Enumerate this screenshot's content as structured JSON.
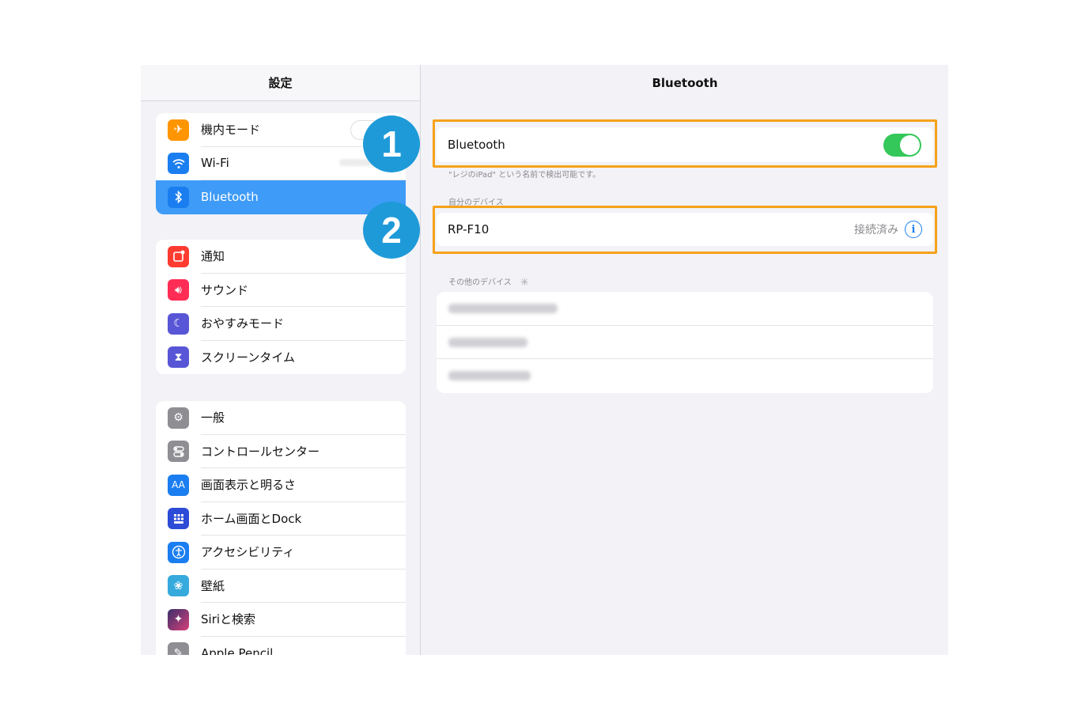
{
  "sidebar": {
    "title": "設定",
    "group1": [
      {
        "label": "機内モード",
        "icon": "airplane-icon",
        "color": "#ff9500"
      },
      {
        "label": "Wi-Fi",
        "icon": "wifi-icon",
        "color": "#1a7ef0"
      },
      {
        "label": "Bluetooth",
        "icon": "bluetooth-icon",
        "color": "#1a7ef0"
      }
    ],
    "group2": [
      {
        "label": "通知",
        "icon": "notifications-icon",
        "color": "#ff3b30"
      },
      {
        "label": "サウンド",
        "icon": "sound-icon",
        "color": "#ff2d55"
      },
      {
        "label": "おやすみモード",
        "icon": "moon-icon",
        "color": "#5856d6"
      },
      {
        "label": "スクリーンタイム",
        "icon": "hourglass-icon",
        "color": "#5856d6"
      }
    ],
    "group3": [
      {
        "label": "一般",
        "icon": "gear-icon",
        "color": "#8e8e93"
      },
      {
        "label": "コントロールセンター",
        "icon": "control-center-icon",
        "color": "#8e8e93"
      },
      {
        "label": "画面表示と明るさ",
        "icon": "display-icon",
        "color": "#1a7ef0"
      },
      {
        "label": "ホーム画面とDock",
        "icon": "home-grid-icon",
        "color": "#2c4bd6"
      },
      {
        "label": "アクセシビリティ",
        "icon": "accessibility-icon",
        "color": "#1a7ef0"
      },
      {
        "label": "壁紙",
        "icon": "wallpaper-icon",
        "color": "#36aadc"
      },
      {
        "label": "Siriと検索",
        "icon": "siri-icon",
        "color": "#333344"
      },
      {
        "label": "Apple Pencil",
        "icon": "pencil-icon",
        "color": "#8e8e93"
      }
    ]
  },
  "detail": {
    "title": "Bluetooth",
    "bluetooth_label": "Bluetooth",
    "discoverable_note": "\"レジのiPad\" という名前で検出可能です。",
    "my_devices_header": "自分のデバイス",
    "device_name": "RP-F10",
    "device_status": "接続済み",
    "other_devices_header": "その他のデバイス"
  },
  "callouts": {
    "one": "1",
    "two": "2"
  },
  "colors": {
    "highlight": "#f5a21a",
    "badge": "#1e9ad8",
    "toggle_on": "#34c759",
    "selected": "#3e9bf7"
  }
}
